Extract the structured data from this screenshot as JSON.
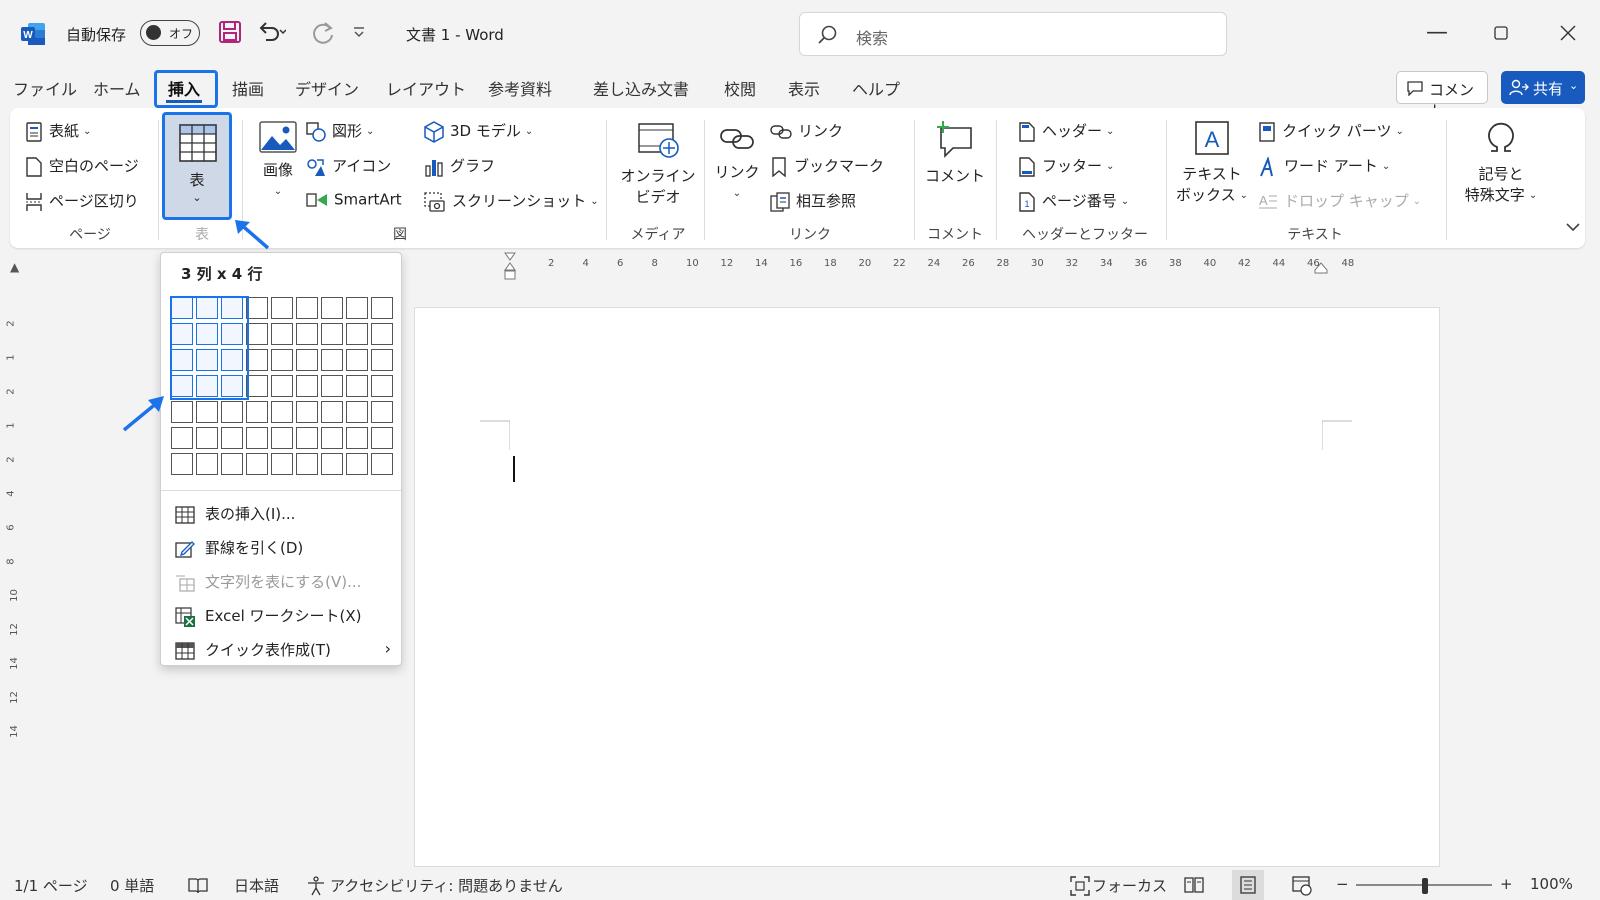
{
  "titlebar": {
    "autosave_label": "自動保存",
    "autosave_state": "オフ",
    "doc_title": "文書 1 - Word",
    "search_placeholder": "検索"
  },
  "menu": {
    "tabs": [
      "ファイル",
      "ホーム",
      "挿入",
      "描画",
      "デザイン",
      "レイアウト",
      "参考資料",
      "差し込み文書",
      "校閲",
      "表示",
      "ヘルプ"
    ],
    "active_tab": "挿入",
    "comment_label": "コメント",
    "share_label": "共有"
  },
  "ribbon": {
    "page_group": {
      "cover": "表紙",
      "blank_page": "空白のページ",
      "page_break": "ページ区切り",
      "label": "ページ"
    },
    "table_group": {
      "table": "表",
      "label": "表"
    },
    "illustrations": {
      "picture": "画像",
      "shapes": "図形",
      "icons": "アイコン",
      "smartart": "SmartArt",
      "model3d": "3D モデル",
      "chart": "グラフ",
      "screenshot": "スクリーンショット",
      "label": "図"
    },
    "media": {
      "online_video_1": "オンライン",
      "online_video_2": "ビデオ",
      "label": "メディア"
    },
    "links": {
      "link_big": "リンク",
      "link": "リンク",
      "bookmark": "ブックマーク",
      "cross_ref": "相互参照",
      "label": "リンク"
    },
    "comments": {
      "comment": "コメント",
      "label": "コメント"
    },
    "header_footer": {
      "header": "ヘッダー",
      "footer": "フッター",
      "page_number": "ページ番号",
      "label": "ヘッダーとフッター"
    },
    "text": {
      "textbox_1": "テキスト",
      "textbox_2": "ボックス",
      "quick_parts": "クイック パーツ",
      "wordart": "ワード アート",
      "dropcap": "ドロップ キャップ",
      "label": "テキスト"
    },
    "symbols": {
      "line1": "記号と",
      "line2": "特殊文字"
    }
  },
  "table_dropdown": {
    "title": "3 列 x 4 行",
    "selected_cols": 3,
    "selected_rows": 4,
    "grid_cols": 9,
    "grid_rows": 7,
    "items": {
      "insert_table": "表の挿入(I)...",
      "draw_table": "罫線を引く(D)",
      "text_to_table": "文字列を表にする(V)...",
      "excel_sheet": "Excel ワークシート(X)",
      "quick_tables": "クイック表作成(T)"
    }
  },
  "ruler": {
    "h_ticks": [
      "2",
      "4",
      "6",
      "8",
      "10",
      "12",
      "14",
      "16",
      "18",
      "20",
      "22",
      "24",
      "26",
      "28",
      "30",
      "32",
      "34",
      "36",
      "38",
      "40",
      "42",
      "44",
      "46",
      "48"
    ],
    "v_ticks": [
      "2",
      "1",
      "2",
      "1",
      "2",
      "4",
      "6",
      "8",
      "10",
      "12",
      "14",
      "12",
      "14"
    ]
  },
  "statusbar": {
    "page": "1/1 ページ",
    "words": "0 単語",
    "language": "日本語",
    "accessibility": "アクセシビリティ: 問題ありません",
    "focus": "フォーカス",
    "zoom_minus": "−",
    "zoom_plus": "+",
    "zoom": "100%"
  },
  "colors": {
    "accent": "#185abd",
    "highlight": "#1a73e8"
  }
}
